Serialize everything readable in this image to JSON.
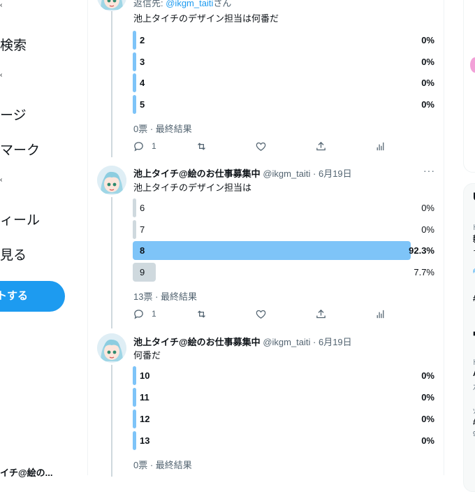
{
  "left_nav": {
    "items": [
      "検索",
      "ージ",
      "マーク",
      "ィール",
      "見る"
    ],
    "tweet_button": "トする",
    "account_name": "イチ@絵の..."
  },
  "tweets": [
    {
      "reply_to_prefix": "返信先: ",
      "reply_to_handle": "@ikgm_taiti",
      "reply_to_suffix": "さん",
      "text": "池上タイチのデザイン担当は何番だ",
      "poll": [
        {
          "label": "2",
          "pct": "0%",
          "value": 0
        },
        {
          "label": "3",
          "pct": "0%",
          "value": 0
        },
        {
          "label": "4",
          "pct": "0%",
          "value": 0
        },
        {
          "label": "5",
          "pct": "0%",
          "value": 0
        }
      ],
      "poll_meta": "0票 · 最終結果",
      "reply_count": "1"
    },
    {
      "name": "池上タイチ@絵のお仕事募集中",
      "handle": "@ikgm_taiti · 6月19日",
      "text": "池上タイチのデザイン担当は",
      "poll": [
        {
          "label": "6",
          "pct": "0%",
          "value": 0
        },
        {
          "label": "7",
          "pct": "0%",
          "value": 0
        },
        {
          "label": "8",
          "pct": "92.3%",
          "value": 92.3
        },
        {
          "label": "9",
          "pct": "7.7%",
          "value": 7.7
        }
      ],
      "poll_meta": "13票 · 最終結果",
      "reply_count": "1"
    },
    {
      "name": "池上タイチ@絵のお仕事募集中",
      "handle": "@ikgm_taiti · 6月19日",
      "text": "何番だ",
      "poll": [
        {
          "label": "10",
          "pct": "0%",
          "value": 0
        },
        {
          "label": "11",
          "pct": "0%",
          "value": 0
        },
        {
          "label": "12",
          "pct": "0%",
          "value": 0
        },
        {
          "label": "13",
          "pct": "0%",
          "value": 0
        }
      ],
      "poll_meta": "0票 · 最終結果"
    }
  ],
  "more_label": "···",
  "right_sidebar": {
    "frags": [
      "U",
      "ﾄ",
      "新",
      "そ",
      "#",
      "#",
      "■",
      "ﾄ",
      "A",
      "ｽ",
      "ｿ",
      "#",
      "9"
    ]
  },
  "colors": {
    "accent": "#1d9bf0",
    "poll_win": "#7ec4f8",
    "poll_lose": "#cfd9de"
  }
}
